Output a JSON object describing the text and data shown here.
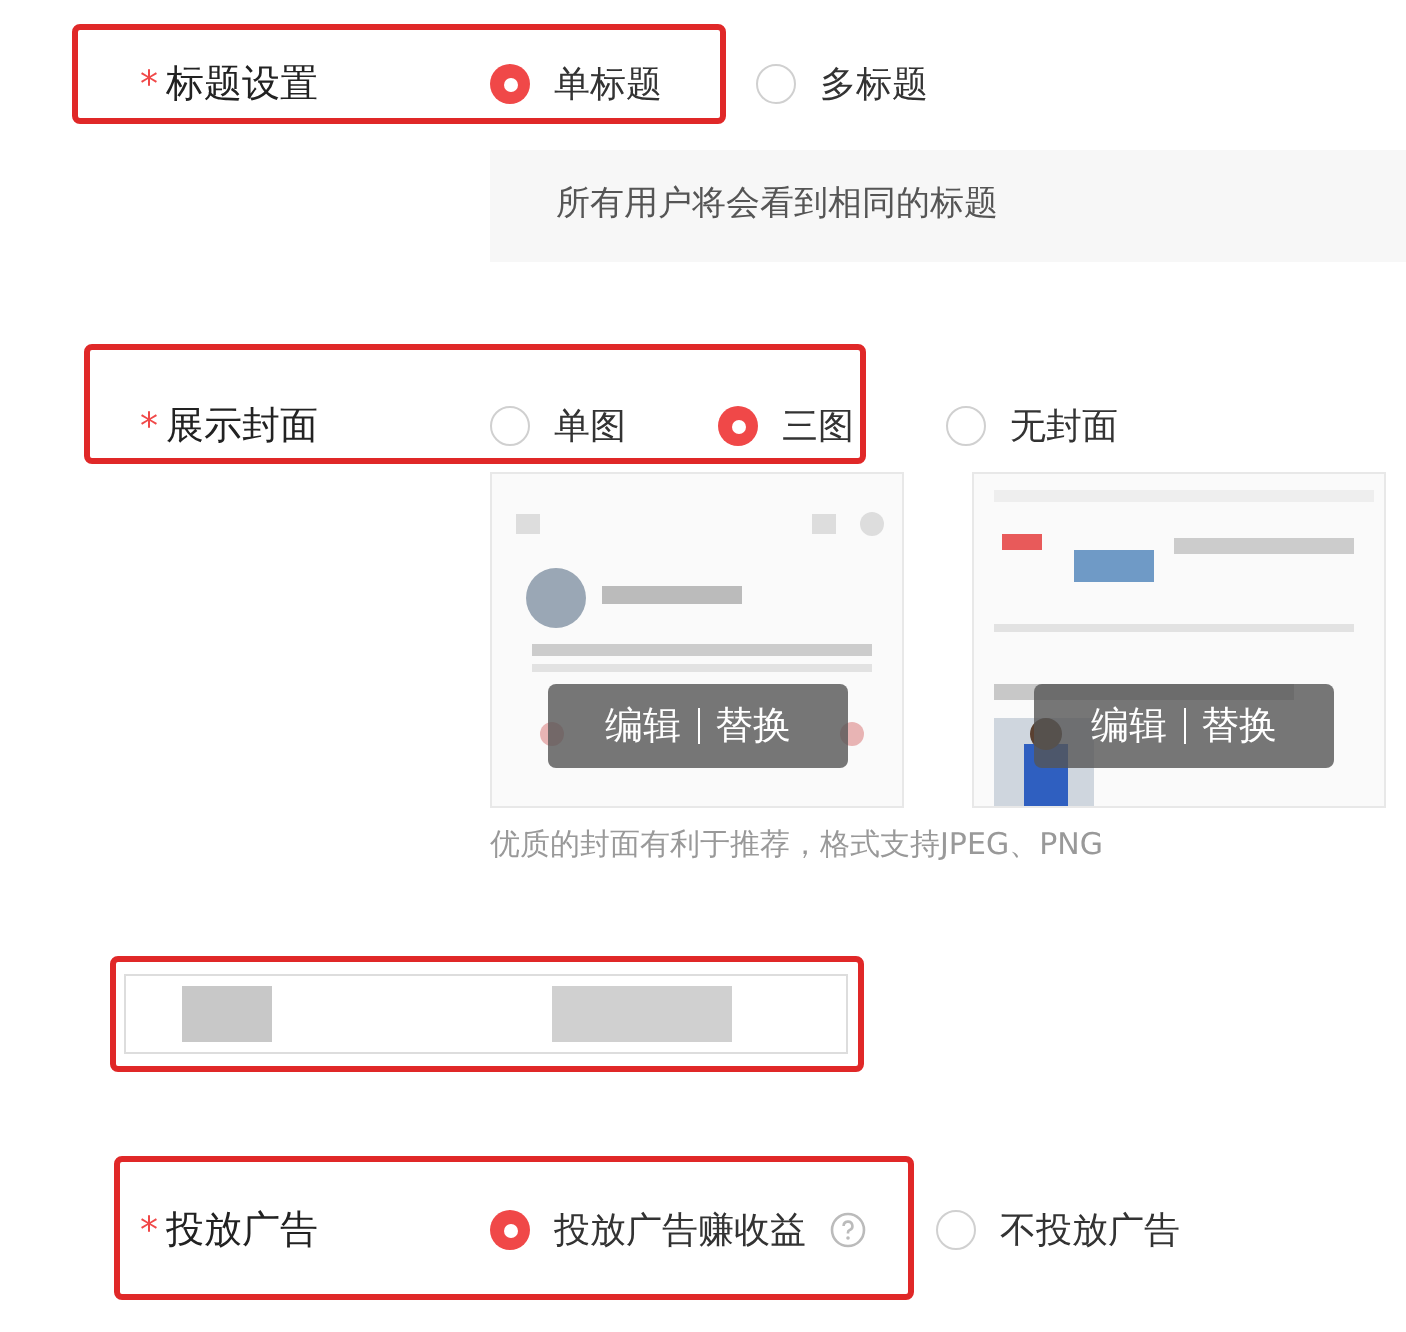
{
  "title_setting": {
    "required_mark": "*",
    "label": "标题设置",
    "options": [
      {
        "label": "单标题",
        "selected": true
      },
      {
        "label": "多标题",
        "selected": false
      }
    ],
    "hint": "所有用户将会看到相同的标题"
  },
  "cover": {
    "required_mark": "*",
    "label": "展示封面",
    "options": [
      {
        "label": "单图",
        "selected": false
      },
      {
        "label": "三图",
        "selected": true
      },
      {
        "label": "无封面",
        "selected": false
      }
    ],
    "images": [
      {
        "kind": "picture",
        "actions": [
          "编辑",
          "替换"
        ]
      },
      {
        "kind": "picture",
        "actions": [
          "编辑",
          "替换"
        ]
      }
    ],
    "caption": "优质的封面有利于推荐，格式支持JPEG、PNG"
  },
  "ads": {
    "required_mark": "*",
    "label": "投放广告",
    "options": [
      {
        "label": "投放广告赚收益",
        "selected": true,
        "help": true
      },
      {
        "label": "不投放广告",
        "selected": false,
        "help": false
      }
    ]
  }
}
